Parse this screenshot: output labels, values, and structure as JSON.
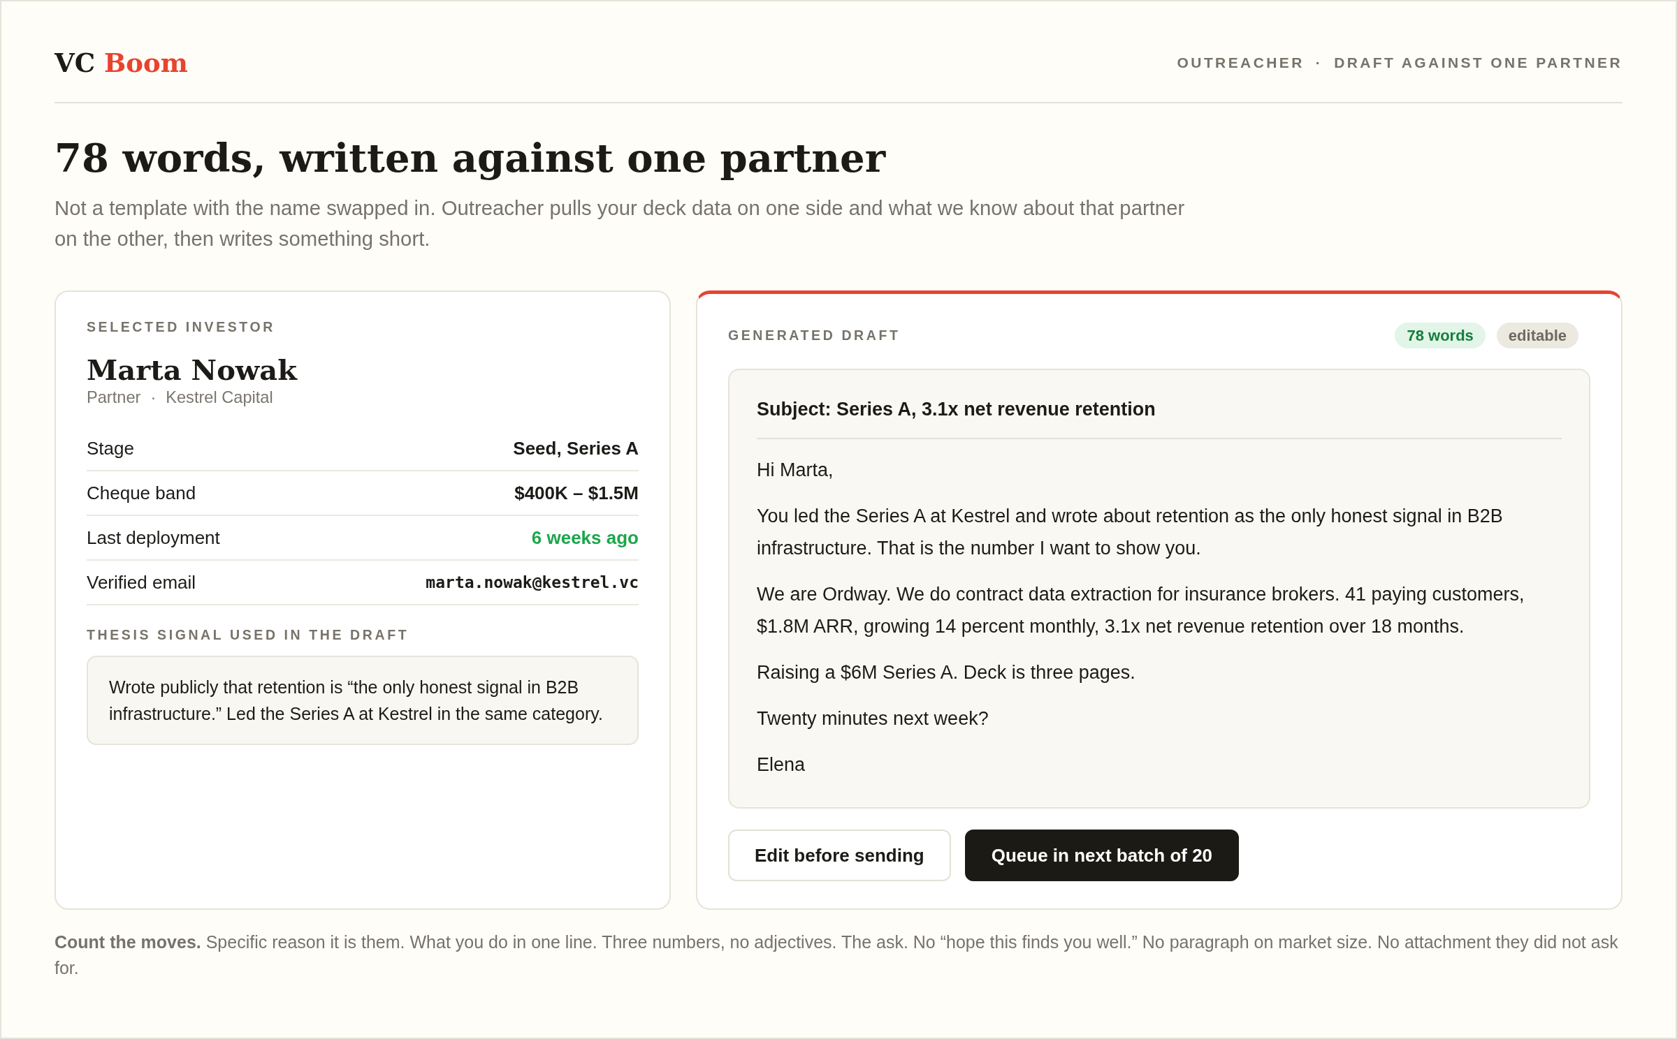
{
  "brand": {
    "wordmark": "VC",
    "wordmark_accent": "Boom"
  },
  "header_nav": {
    "product": "OUTREACHER",
    "separator": "·",
    "page": "DRAFT AGAINST ONE PARTNER"
  },
  "hero": {
    "title": "78 words, written against one partner",
    "subtitle": "Not a template with the name swapped in. Outreacher pulls your deck data on one side and what we know about that partner on the other, then writes something short."
  },
  "investor_card": {
    "label": "SELECTED INVESTOR",
    "name": "Marta Nowak",
    "role": "Partner",
    "separator": "·",
    "firm": "Kestrel Capital",
    "facts": [
      {
        "label": "Stage",
        "value": "Seed, Series A",
        "kind": "text"
      },
      {
        "label": "Cheque band",
        "value": "$400K – $1.5M",
        "kind": "text"
      },
      {
        "label": "Last deployment",
        "value": "6 weeks ago",
        "kind": "positive"
      },
      {
        "label": "Verified email",
        "value": "marta.nowak@kestrel.vc",
        "kind": "email"
      }
    ],
    "thesis_label": "THESIS SIGNAL USED IN THE DRAFT",
    "thesis": "Wrote publicly that retention is “the only honest signal in B2B infrastructure.” Led the Series A at Kestrel in the same category."
  },
  "draft_card": {
    "label": "GENERATED DRAFT",
    "badges": [
      {
        "text": "78 words",
        "kind": "count"
      },
      {
        "text": "editable",
        "kind": "status"
      }
    ],
    "subject": "Subject: Series A, 3.1x net revenue retention",
    "body": [
      "Hi Marta,",
      "You led the Series A at Kestrel and wrote about retention as the only honest signal in B2B infrastructure. That is the number I want to show you.",
      "We are Ordway. We do contract data extraction for insurance brokers. 41 paying customers, $1.8M ARR, growing 14 percent monthly, 3.1x net revenue retention over 18 months.",
      "Raising a $6M Series A. Deck is three pages.",
      "Twenty minutes next week?",
      "Elena"
    ],
    "actions": [
      {
        "label": "Edit before sending",
        "kind": "outline"
      },
      {
        "label": "Queue in next batch of 20",
        "kind": "solid"
      }
    ]
  },
  "footer_note": "**Count the moves.** Specific reason it is them. What you do in one line. Three numbers, no adjectives. The ask. No “hope this finds you well.” No paragraph on market size. No attachment they did not ask for."
}
